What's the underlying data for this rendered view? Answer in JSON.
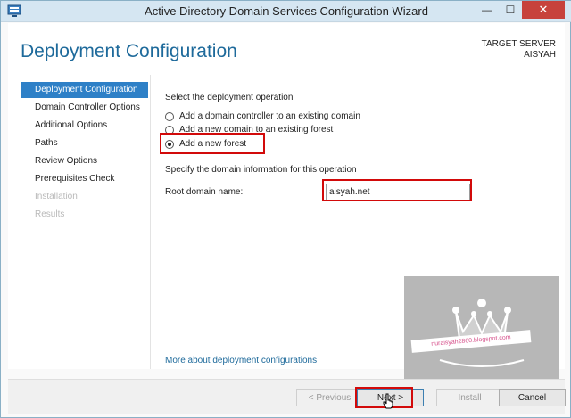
{
  "window": {
    "title": "Active Directory Domain Services Configuration Wizard",
    "controls": {
      "minimize": "—",
      "maximize": "☐",
      "close": "✕"
    }
  },
  "header": {
    "page_title": "Deployment Configuration",
    "target_server_label": "TARGET SERVER",
    "target_server_name": "AISYAH"
  },
  "sidebar": {
    "items": [
      {
        "label": "Deployment Configuration",
        "state": "active"
      },
      {
        "label": "Domain Controller Options",
        "state": "enabled"
      },
      {
        "label": "Additional Options",
        "state": "enabled"
      },
      {
        "label": "Paths",
        "state": "enabled"
      },
      {
        "label": "Review Options",
        "state": "enabled"
      },
      {
        "label": "Prerequisites Check",
        "state": "enabled"
      },
      {
        "label": "Installation",
        "state": "disabled"
      },
      {
        "label": "Results",
        "state": "disabled"
      }
    ]
  },
  "main": {
    "select_operation_label": "Select the deployment operation",
    "options": [
      {
        "label": "Add a domain controller to an existing domain",
        "checked": false
      },
      {
        "label": "Add a new domain to an existing forest",
        "checked": false
      },
      {
        "label": "Add a new forest",
        "checked": true
      }
    ],
    "specify_label": "Specify the domain information for this operation",
    "root_domain_label": "Root domain name:",
    "root_domain_value": "aisyah.net",
    "more_link": "More about deployment configurations"
  },
  "watermark": {
    "text": "nuraisyah2860.blogspot.com"
  },
  "buttons": {
    "previous": "< Previous",
    "next": "Next >",
    "install": "Install",
    "cancel": "Cancel"
  },
  "colors": {
    "accent": "#2e80c7",
    "title_blue": "#1e6a9b",
    "highlight_red": "#d20a0a",
    "close_red": "#c7423c"
  }
}
